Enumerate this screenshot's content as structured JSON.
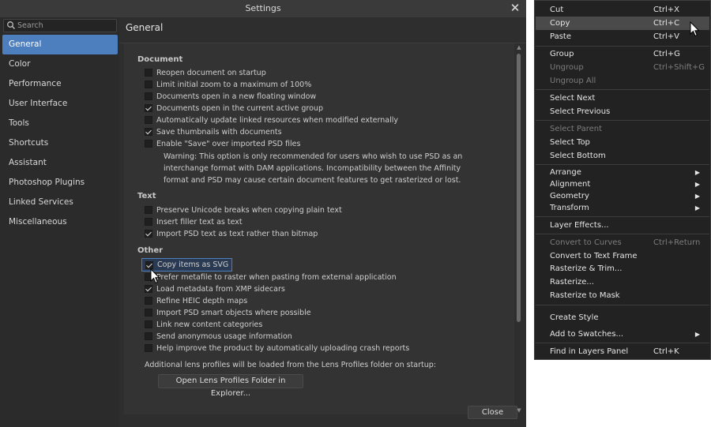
{
  "settings": {
    "title": "Settings",
    "search_placeholder": "Search",
    "page_title": "General",
    "nav": [
      "General",
      "Color",
      "Performance",
      "User Interface",
      "Tools",
      "Shortcuts",
      "Assistant",
      "Photoshop Plugins",
      "Linked Services",
      "Miscellaneous"
    ],
    "sections": {
      "document": "Document",
      "text": "Text",
      "other": "Other"
    },
    "document_options": [
      {
        "label": "Reopen document on startup",
        "checked": false
      },
      {
        "label": "Limit initial zoom to a maximum of 100%",
        "checked": false
      },
      {
        "label": "Documents open in a new floating window",
        "checked": false
      },
      {
        "label": "Documents open in the current active group",
        "checked": true
      },
      {
        "label": "Automatically update linked resources when modified externally",
        "checked": false
      },
      {
        "label": "Save thumbnails with documents",
        "checked": true
      },
      {
        "label": "Enable \"Save\" over imported PSD files",
        "checked": false
      }
    ],
    "warning": "Warning: This option is only recommended for users who wish to use PSD as an interchange format with DAM applications. Incompatibility between the Affinity format and PSD may cause certain document features to get rasterized or lost.",
    "text_options": [
      {
        "label": "Preserve Unicode breaks when copying plain text",
        "checked": false
      },
      {
        "label": "Insert filler text as text",
        "checked": false
      },
      {
        "label": "Import PSD text as text rather than bitmap",
        "checked": true
      }
    ],
    "other_options": [
      {
        "label": "Copy items as SVG",
        "checked": true
      },
      {
        "label": "Prefer metafile to raster when pasting from external application",
        "checked": false
      },
      {
        "label": "Load metadata from XMP sidecars",
        "checked": true
      },
      {
        "label": "Refine HEIC depth maps",
        "checked": false
      },
      {
        "label": "Import PSD smart objects where possible",
        "checked": false
      },
      {
        "label": "Link new content categories",
        "checked": false
      },
      {
        "label": "Send anonymous usage information",
        "checked": false
      },
      {
        "label": "Help improve the product by automatically uploading crash reports",
        "checked": false
      }
    ],
    "lens_note": "Additional lens profiles will be loaded from the Lens Profiles folder on startup:",
    "lens_button": "Open Lens Profiles Folder in Explorer...",
    "close_button": "Close",
    "close_glyph": "✕"
  },
  "menu": {
    "items": [
      {
        "label": "Cut",
        "shortcut": "Ctrl+X",
        "state": "normal"
      },
      {
        "label": "Copy",
        "shortcut": "Ctrl+C",
        "state": "highlighted"
      },
      {
        "label": "Paste",
        "shortcut": "Ctrl+V",
        "state": "normal"
      },
      {
        "label": "Group",
        "shortcut": "Ctrl+G",
        "state": "normal"
      },
      {
        "label": "Ungroup",
        "shortcut": "Ctrl+Shift+G",
        "state": "disabled"
      },
      {
        "label": "Ungroup All",
        "shortcut": "",
        "state": "disabled"
      },
      {
        "label": "Select Next",
        "shortcut": "",
        "state": "normal"
      },
      {
        "label": "Select Previous",
        "shortcut": "",
        "state": "normal"
      },
      {
        "label": "Select Parent",
        "shortcut": "",
        "state": "disabled"
      },
      {
        "label": "Select Top",
        "shortcut": "",
        "state": "normal"
      },
      {
        "label": "Select Bottom",
        "shortcut": "",
        "state": "normal"
      },
      {
        "label": "Arrange",
        "shortcut": "",
        "state": "normal",
        "submenu": true
      },
      {
        "label": "Alignment",
        "shortcut": "",
        "state": "normal",
        "submenu": true
      },
      {
        "label": "Geometry",
        "shortcut": "",
        "state": "normal",
        "submenu": true
      },
      {
        "label": "Transform",
        "shortcut": "",
        "state": "normal",
        "submenu": true
      },
      {
        "label": "Layer Effects...",
        "shortcut": "",
        "state": "normal"
      },
      {
        "label": "Convert to Curves",
        "shortcut": "Ctrl+Return",
        "state": "disabled"
      },
      {
        "label": "Convert to Text Frame",
        "shortcut": "",
        "state": "normal"
      },
      {
        "label": "Rasterize & Trim...",
        "shortcut": "",
        "state": "normal"
      },
      {
        "label": "Rasterize...",
        "shortcut": "",
        "state": "normal"
      },
      {
        "label": "Rasterize to Mask",
        "shortcut": "",
        "state": "normal"
      },
      {
        "label": "Create Style",
        "shortcut": "",
        "state": "normal"
      },
      {
        "label": "Add to Swatches...",
        "shortcut": "",
        "state": "normal",
        "submenu": true
      },
      {
        "label": "Find in Layers Panel",
        "shortcut": "Ctrl+K",
        "state": "normal"
      }
    ],
    "submenu_glyph": "▶"
  },
  "colors": {
    "accent": "#4d7fbf",
    "window_bg": "#2e2e2e",
    "menu_bg": "#222222"
  },
  "icons": [
    "search-icon",
    "close-icon",
    "checkbox-check-icon",
    "submenu-arrow-icon",
    "mouse-cursor-icon"
  ]
}
